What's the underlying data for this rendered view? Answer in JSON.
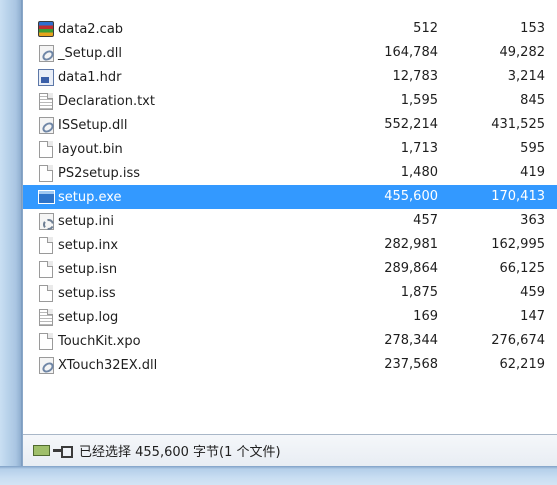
{
  "files": [
    {
      "name": "data2.cab",
      "size": "512",
      "packed": "153",
      "icon": "cab-archive-icon"
    },
    {
      "name": "_Setup.dll",
      "size": "164,784",
      "packed": "49,282",
      "icon": "dll-file-icon"
    },
    {
      "name": "data1.hdr",
      "size": "12,783",
      "packed": "3,214",
      "icon": "hdr-file-icon"
    },
    {
      "name": "Declaration.txt",
      "size": "1,595",
      "packed": "845",
      "icon": "text-file-icon"
    },
    {
      "name": "ISSetup.dll",
      "size": "552,214",
      "packed": "431,525",
      "icon": "dll-file-icon"
    },
    {
      "name": "layout.bin",
      "size": "1,713",
      "packed": "595",
      "icon": "generic-file-icon"
    },
    {
      "name": "PS2setup.iss",
      "size": "1,480",
      "packed": "419",
      "icon": "generic-file-icon"
    },
    {
      "name": "setup.exe",
      "size": "455,600",
      "packed": "170,413",
      "icon": "exe-file-icon",
      "selected": true
    },
    {
      "name": "setup.ini",
      "size": "457",
      "packed": "363",
      "icon": "ini-settings-icon"
    },
    {
      "name": "setup.inx",
      "size": "282,981",
      "packed": "162,995",
      "icon": "generic-file-icon"
    },
    {
      "name": "setup.isn",
      "size": "289,864",
      "packed": "66,125",
      "icon": "generic-file-icon"
    },
    {
      "name": "setup.iss",
      "size": "1,875",
      "packed": "459",
      "icon": "generic-file-icon"
    },
    {
      "name": "setup.log",
      "size": "169",
      "packed": "147",
      "icon": "text-file-icon"
    },
    {
      "name": "TouchKit.xpo",
      "size": "278,344",
      "packed": "276,674",
      "icon": "generic-file-icon"
    },
    {
      "name": "XTouch32EX.dll",
      "size": "237,568",
      "packed": "62,219",
      "icon": "dll-file-icon"
    }
  ],
  "status": {
    "text": "已经选择 455,600 字节(1 个文件)",
    "icons": [
      "archive-status-icon",
      "drive-status-icon"
    ]
  },
  "colors": {
    "selection": "#3399ff",
    "frame": "#b8d2ea"
  }
}
